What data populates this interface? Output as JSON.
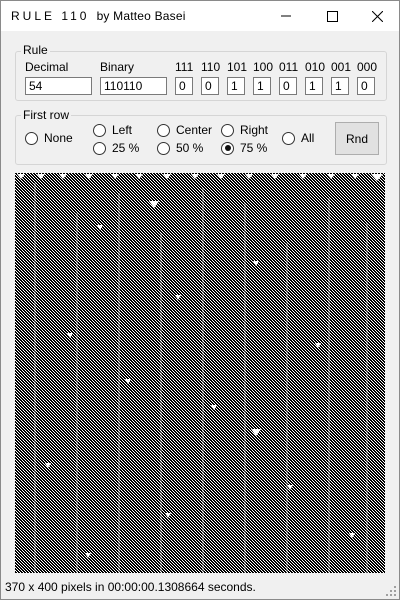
{
  "window": {
    "title_prefix": "RULE 110",
    "title_suffix": "by Matteo Basei"
  },
  "rule": {
    "group_label": "Rule",
    "decimal_label": "Decimal",
    "decimal_value": "54",
    "binary_label": "Binary",
    "binary_value": "110110",
    "bits": [
      {
        "pattern": "111",
        "value": "0"
      },
      {
        "pattern": "110",
        "value": "0"
      },
      {
        "pattern": "101",
        "value": "1"
      },
      {
        "pattern": "100",
        "value": "1"
      },
      {
        "pattern": "011",
        "value": "0"
      },
      {
        "pattern": "010",
        "value": "1"
      },
      {
        "pattern": "001",
        "value": "1"
      },
      {
        "pattern": "000",
        "value": "0"
      }
    ]
  },
  "first_row": {
    "group_label": "First row",
    "options": [
      {
        "label": "None",
        "checked": false
      },
      {
        "label": "Left",
        "checked": false
      },
      {
        "label": "25 %",
        "checked": false
      },
      {
        "label": "Center",
        "checked": false
      },
      {
        "label": "50 %",
        "checked": false
      },
      {
        "label": "Right",
        "checked": false
      },
      {
        "label": "75 %",
        "checked": true
      },
      {
        "label": "All",
        "checked": false
      }
    ],
    "rnd_label": "Rnd"
  },
  "status": {
    "text": "370 x 400 pixels in 00:00:00.1308664 seconds."
  }
}
